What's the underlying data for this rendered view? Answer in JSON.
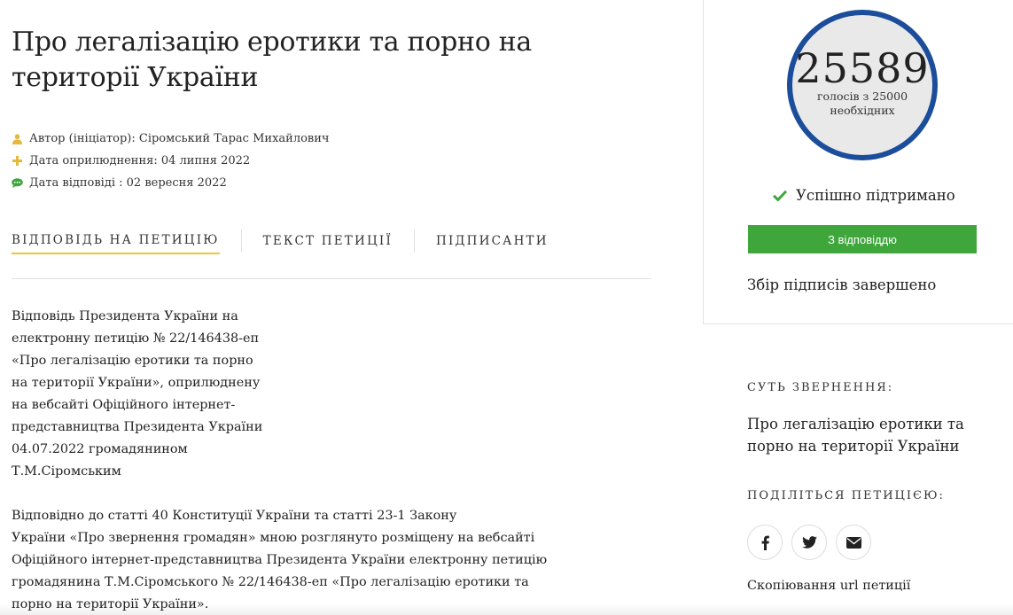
{
  "petition": {
    "title": "Про легалізацію еротики та порно на території України",
    "meta": {
      "author": "Автор (ініціатор): Сіромський Тарас Михайлович",
      "published": "Дата оприлюднення: 04 липня 2022",
      "answered": "Дата відповіді : 02 вересня 2022",
      "icons": [
        "user-icon",
        "plus-icon",
        "speech-bubble-icon"
      ]
    },
    "tabs": [
      {
        "label": "Відповідь на петицію",
        "active": true
      },
      {
        "label": "Текст петиції",
        "active": false
      },
      {
        "label": "Підписанти",
        "active": false
      }
    ],
    "answer": {
      "p1": "Відповідь Президента України на\nелектронну петицію № 22/146438-еп\n«Про легалізацію еротики та порно\nна території України», оприлюднену\nна вебсайті Офіційного інтернет-\nпредставництва Президента України\n04.07.2022 громадянином\nТ.М.Сіромським",
      "p2": "Відповідно до статті 40 Конституції України та статті 23-1 Закону\nУкраїни «Про звернення громадян» мною розглянуто розміщену на вебсайті\nОфіційного інтернет-представництва Президента України електронну петицію\nгромадянина Т.М.Сіромського № 22/146438-еп «Про легалізацію еротики та\nпорно на території України»."
    }
  },
  "sidebar": {
    "votes": "25589",
    "votes_caption": "голосів з 25000 необхідних",
    "status": "Успішно підтримано",
    "answer_button": "З відповіддю",
    "closed": "Збір підписів завершено",
    "essence_label": "Суть звернення:",
    "essence_text": "Про легалізацію еротики та порно на території України",
    "share_label": "Поділіться петицією:",
    "share_icons": [
      "facebook-icon",
      "twitter-icon",
      "email-icon"
    ],
    "copy_url": "Скопіювання url петиції",
    "colors": {
      "ring": "#1b4d9b",
      "button": "#3fa63c",
      "tab_underline": "#f0c438",
      "check": "#3fa63c",
      "meta_icons": "#e7b93a"
    }
  }
}
